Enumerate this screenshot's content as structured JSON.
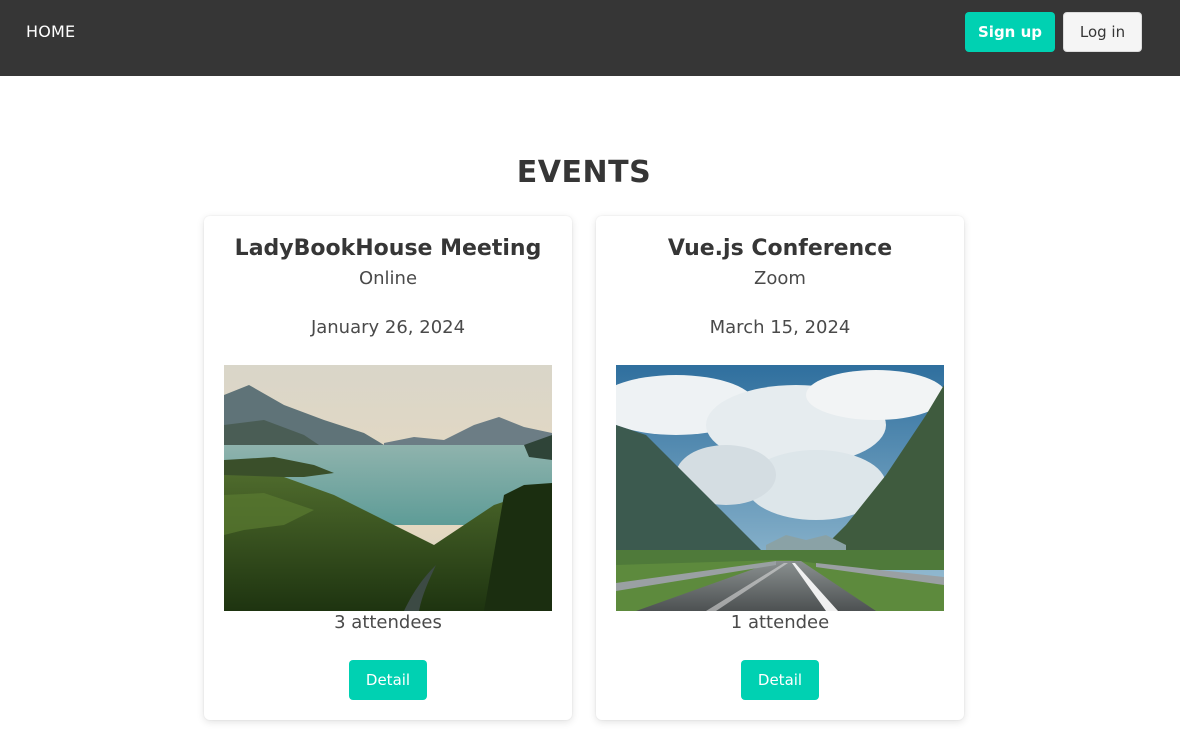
{
  "nav": {
    "home_label": "HOME",
    "signup_label": "Sign up",
    "login_label": "Log in"
  },
  "page": {
    "title": "EVENTS"
  },
  "events": [
    {
      "title": "LadyBookHouse Meeting",
      "location": "Online",
      "date": "January 26, 2024",
      "attendees": "3 attendees",
      "detail_label": "Detail",
      "image": "lake-mountain-forest-photo"
    },
    {
      "title": "Vue.js Conference",
      "location": "Zoom",
      "date": "March 15, 2024",
      "attendees": "1 attendee",
      "detail_label": "Detail",
      "image": "mountain-road-cloudy-sky-photo"
    }
  ],
  "colors": {
    "navbar": "#363636",
    "primary": "#00d1b2",
    "light_button": "#f5f5f5",
    "text": "#363636"
  }
}
